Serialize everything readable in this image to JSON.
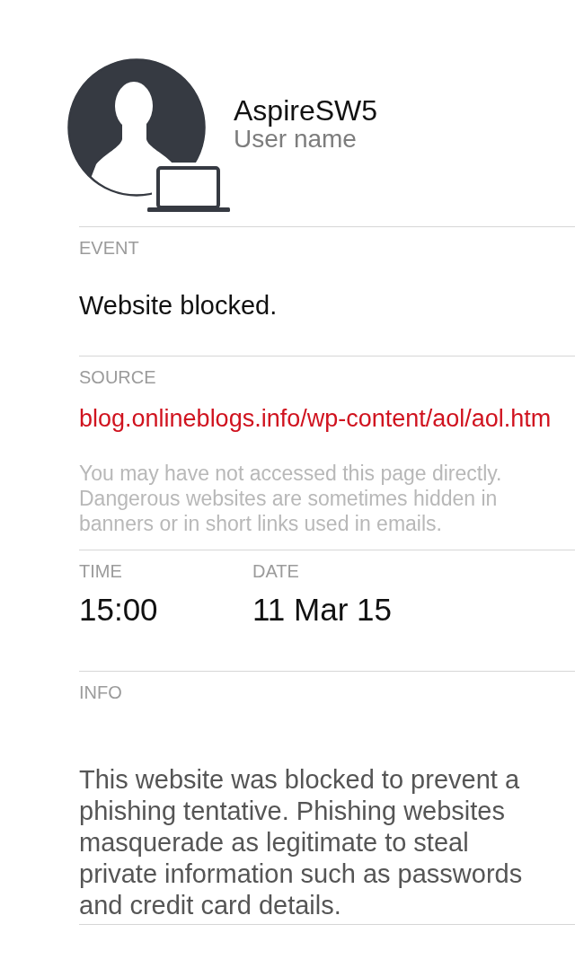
{
  "profile": {
    "device_name": "AspireSW5",
    "subtitle": "User name"
  },
  "sections": [
    {
      "kind": "text",
      "label": "EVENT",
      "value": "Website blocked."
    },
    {
      "kind": "url",
      "label": "SOURCE",
      "value": "blog.onlineblogs.info/wp-content/aol/aol.htm",
      "note": "You may have not accessed this page directly. Dangerous websites are sometimes hidden in banners or in short links used in emails."
    },
    {
      "kind": "pair",
      "fields": [
        {
          "label": "TIME",
          "value": "15:00"
        },
        {
          "label": "DATE",
          "value": "11 Mar 15"
        }
      ]
    },
    {
      "kind": "paragraph",
      "label": "INFO",
      "value": "This website was blocked to prevent a phishing tentative. Phishing websites masquerade as legitimate to steal private information such as passwords and credit card details."
    }
  ]
}
